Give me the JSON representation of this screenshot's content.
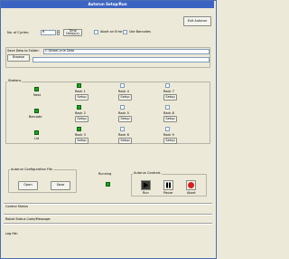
{
  "window": {
    "title": "Autorun Setup/Run"
  },
  "cycles": {
    "label": "No. of Cycles:",
    "value": "6",
    "time_delay_label": "Time Delay(s)"
  },
  "options": {
    "abort_on_error_label": "Abort on Error",
    "use_barcodes_label": "Use Barcodes"
  },
  "exit_label": "Exit Autorun",
  "save_folder": {
    "label": "Save Data to Folder:",
    "browse_label": "Browse",
    "path": "C:\\DataCycle Data"
  },
  "stations": {
    "title": "Stations",
    "nest": {
      "label": "Nest"
    },
    "barcode": {
      "label": "Barcode"
    },
    "lid": {
      "label": "Lid"
    },
    "racks": [
      {
        "label": "Rack 1",
        "setup": "Setup"
      },
      {
        "label": "Rack 2",
        "setup": "Setup"
      },
      {
        "label": "Rack 3",
        "setup": "Setup"
      },
      {
        "label": "Rack 4",
        "setup": "Setup"
      },
      {
        "label": "Rack 5",
        "setup": "Setup"
      },
      {
        "label": "Rack 6",
        "setup": "Setup"
      },
      {
        "label": "Rack 7",
        "setup": "Setup"
      },
      {
        "label": "Rack 8",
        "setup": "Setup"
      },
      {
        "label": "Rack 9",
        "setup": "Setup"
      }
    ]
  },
  "config_file": {
    "title": "Autorun Configuration File",
    "open_label": "Open",
    "save_label": "Save"
  },
  "running": {
    "label": "Running"
  },
  "controls": {
    "title": "Autorun Controls",
    "run_label": "Run",
    "pause_label": "Pause",
    "abort_label": "Abort"
  },
  "status": {
    "control_label": "Control Status",
    "robot_label": "Robot Status Code/Message:",
    "log_label": "Log file:"
  },
  "colors": {
    "led_on": "#19a51d",
    "abort_red": "#d81e1e",
    "title_bar": "#3b64c2"
  }
}
